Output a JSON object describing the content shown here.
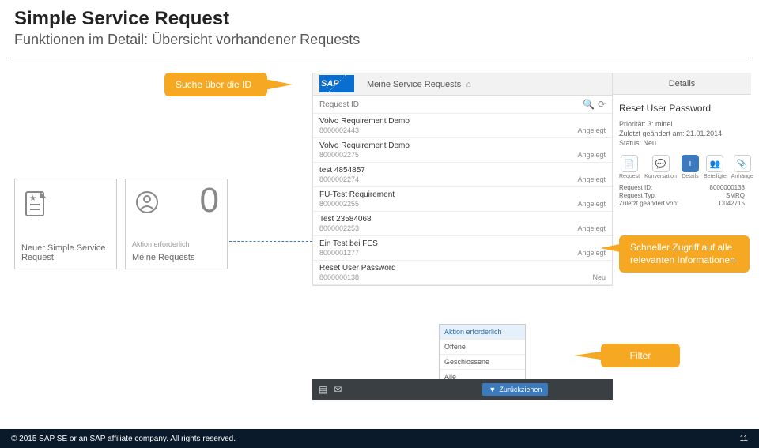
{
  "slide": {
    "title": "Simple Service Request",
    "subtitle": "Funktionen im Detail: Übersicht vorhandener Requests"
  },
  "callouts": {
    "search": "Suche über die ID",
    "info": "Schneller Zugriff auf alle relevanten Informationen",
    "filter": "Filter"
  },
  "tiles": [
    {
      "label": "Neuer Simple Service Request"
    },
    {
      "label": "Meine Requests",
      "sublabel": "Aktion erforderlich",
      "count": "0"
    }
  ],
  "app": {
    "header_title": "Meine Service Requests",
    "search_placeholder": "Request ID"
  },
  "requests": [
    {
      "title": "Volvo Requirement Demo",
      "id": "8000002443",
      "status": "Angelegt"
    },
    {
      "title": "Volvo Requirement Demo",
      "id": "8000002275",
      "status": "Angelegt"
    },
    {
      "title": "test 4854857",
      "id": "8000002274",
      "status": "Angelegt"
    },
    {
      "title": "FU-Test Requirement",
      "id": "8000002255",
      "status": "Angelegt"
    },
    {
      "title": "Test 23584068",
      "id": "8000002253",
      "status": "Angelegt"
    },
    {
      "title": "Ein Test bei FES",
      "id": "8000001277",
      "status": "Angelegt"
    },
    {
      "title": "Reset User Password",
      "id": "8000000138",
      "status": "Neu"
    }
  ],
  "details": {
    "header": "Details",
    "title": "Reset User Password",
    "priority_label": "Priorität: 3: mittel",
    "changed_label": "Zuletzt geändert am: 21.01.2014",
    "status_label": "Status: Neu",
    "tabs": [
      "Request",
      "Konversation",
      "Details",
      "Beteiligte",
      "Anhänge"
    ],
    "rows": [
      {
        "k": "Request ID:",
        "v": "8000000138"
      },
      {
        "k": "Request Typ:",
        "v": "SMRQ"
      },
      {
        "k": "Zuletzt geändert von:",
        "v": "D042715"
      }
    ]
  },
  "dropdown": {
    "items": [
      "Aktion erforderlich",
      "Offene",
      "Geschlossene",
      "Alle"
    ]
  },
  "bottombar": {
    "filter_label": "Zurückziehen"
  },
  "footer": {
    "copyright": "© 2015 SAP SE or an SAP affiliate company. All rights reserved.",
    "page": "11"
  }
}
